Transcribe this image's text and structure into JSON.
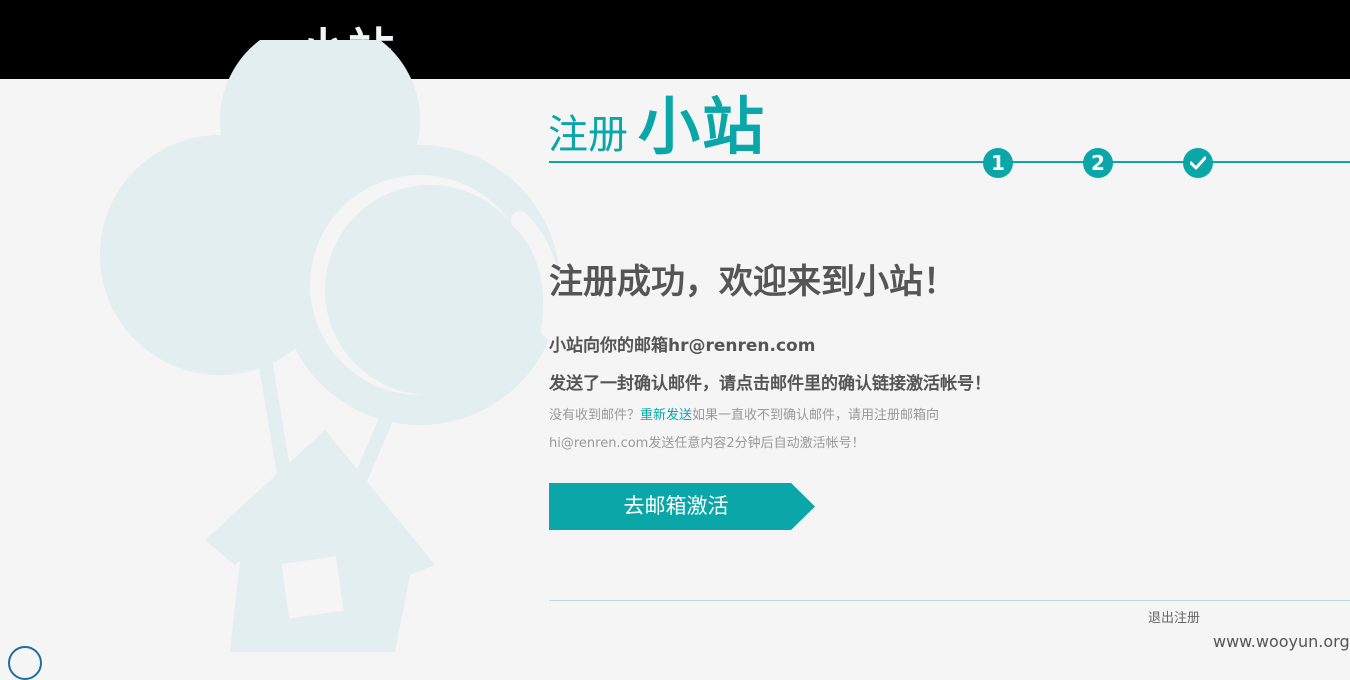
{
  "header": {
    "brand": "小站"
  },
  "register": {
    "title_light": "注册",
    "title_bold": "小站",
    "steps": [
      "1",
      "2"
    ],
    "headline": "注册成功，欢迎来到小站！",
    "email_line": "小站向你的邮箱hr@renren.com",
    "sent_line": "发送了一封确认邮件，请点击邮件里的确认链接激活帐号！",
    "hint_prefix": "没有收到邮件？",
    "resend_link": "重新发送",
    "hint_suffix": "如果一直收不到确认邮件，请用注册邮箱向hi@renren.com发送任意内容2分钟后自动激活帐号！",
    "activate_button": "去邮箱激活",
    "logout_link": "退出注册"
  },
  "watermark": "www.wooyun.org",
  "colors": {
    "accent": "#0aa6a8",
    "topbar": "#000000",
    "background": "#f5f5f5"
  }
}
